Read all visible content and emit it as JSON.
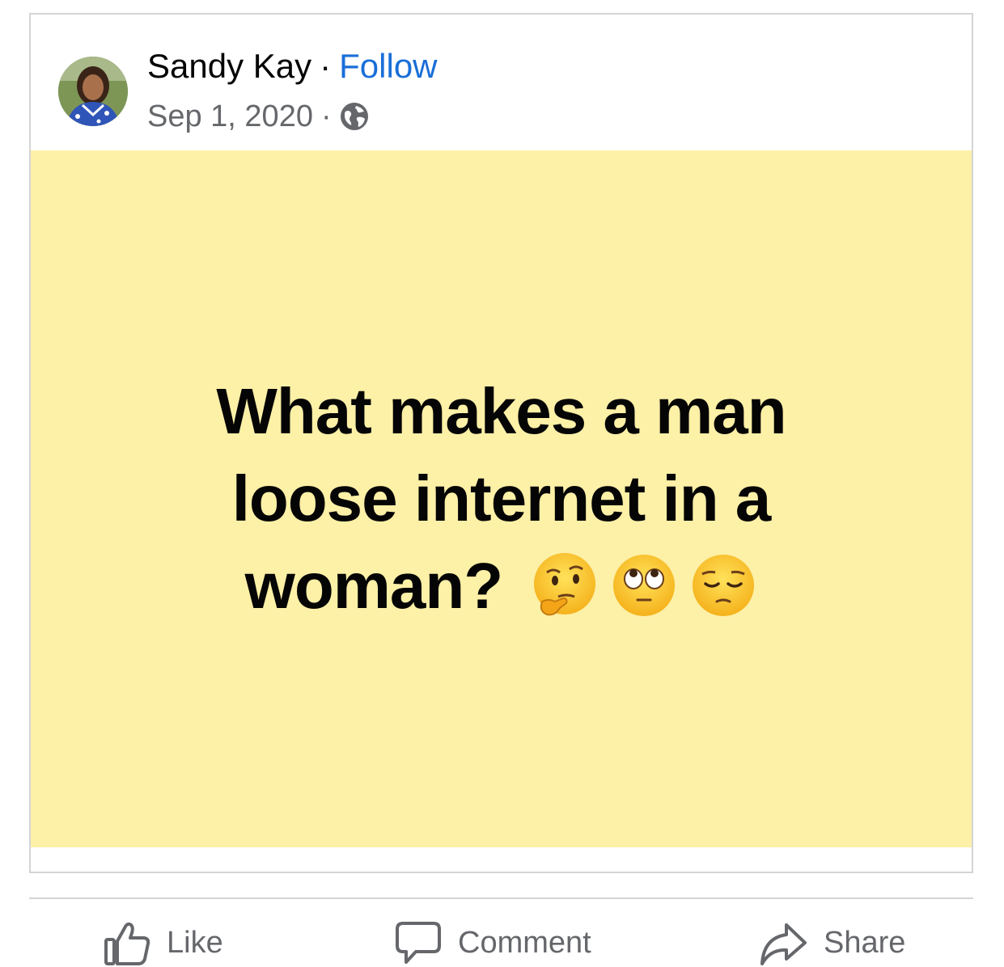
{
  "post": {
    "author_name": "Sandy Kay",
    "separator": "·",
    "follow_label": "Follow",
    "date": "Sep 1, 2020",
    "meta_separator": "·",
    "audience_icon": "globe-icon",
    "status_text": "What makes a man loose internet in a woman?",
    "emojis": [
      "thinking-face",
      "face-with-rolling-eyes",
      "pensive-face"
    ],
    "background_color": "#fdf0a7",
    "follow_color": "#1a6ed8"
  },
  "actions": {
    "like_label": "Like",
    "comment_label": "Comment",
    "share_label": "Share"
  }
}
